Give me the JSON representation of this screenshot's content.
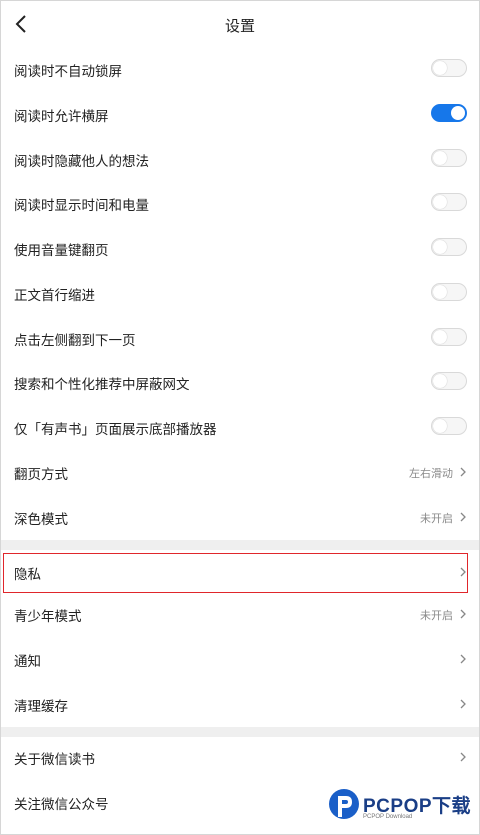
{
  "header": {
    "title": "设置"
  },
  "toggles": [
    {
      "label": "阅读时不自动锁屏",
      "on": false
    },
    {
      "label": "阅读时允许横屏",
      "on": true
    },
    {
      "label": "阅读时隐藏他人的想法",
      "on": false
    },
    {
      "label": "阅读时显示时间和电量",
      "on": false
    },
    {
      "label": "使用音量键翻页",
      "on": false
    },
    {
      "label": "正文首行缩进",
      "on": false
    },
    {
      "label": "点击左侧翻到下一页",
      "on": false
    },
    {
      "label": "搜索和个性化推荐中屏蔽网文",
      "on": false
    },
    {
      "label": "仅「有声书」页面展示底部播放器",
      "on": false
    }
  ],
  "nav_rows": {
    "page_turn": {
      "label": "翻页方式",
      "value": "左右滑动"
    },
    "dark_mode": {
      "label": "深色模式",
      "value": "未开启"
    },
    "privacy": {
      "label": "隐私"
    },
    "teen_mode": {
      "label": "青少年模式",
      "value": "未开启"
    },
    "notify": {
      "label": "通知"
    },
    "clear_cache": {
      "label": "清理缓存"
    },
    "about": {
      "label": "关于微信读书"
    },
    "follow": {
      "label": "关注微信公众号"
    }
  },
  "watermark": {
    "text": "PCPOP下载",
    "sub": "PCPOP Download"
  },
  "colors": {
    "toggle_on": "#1677ea",
    "highlight": "#e0262b"
  }
}
